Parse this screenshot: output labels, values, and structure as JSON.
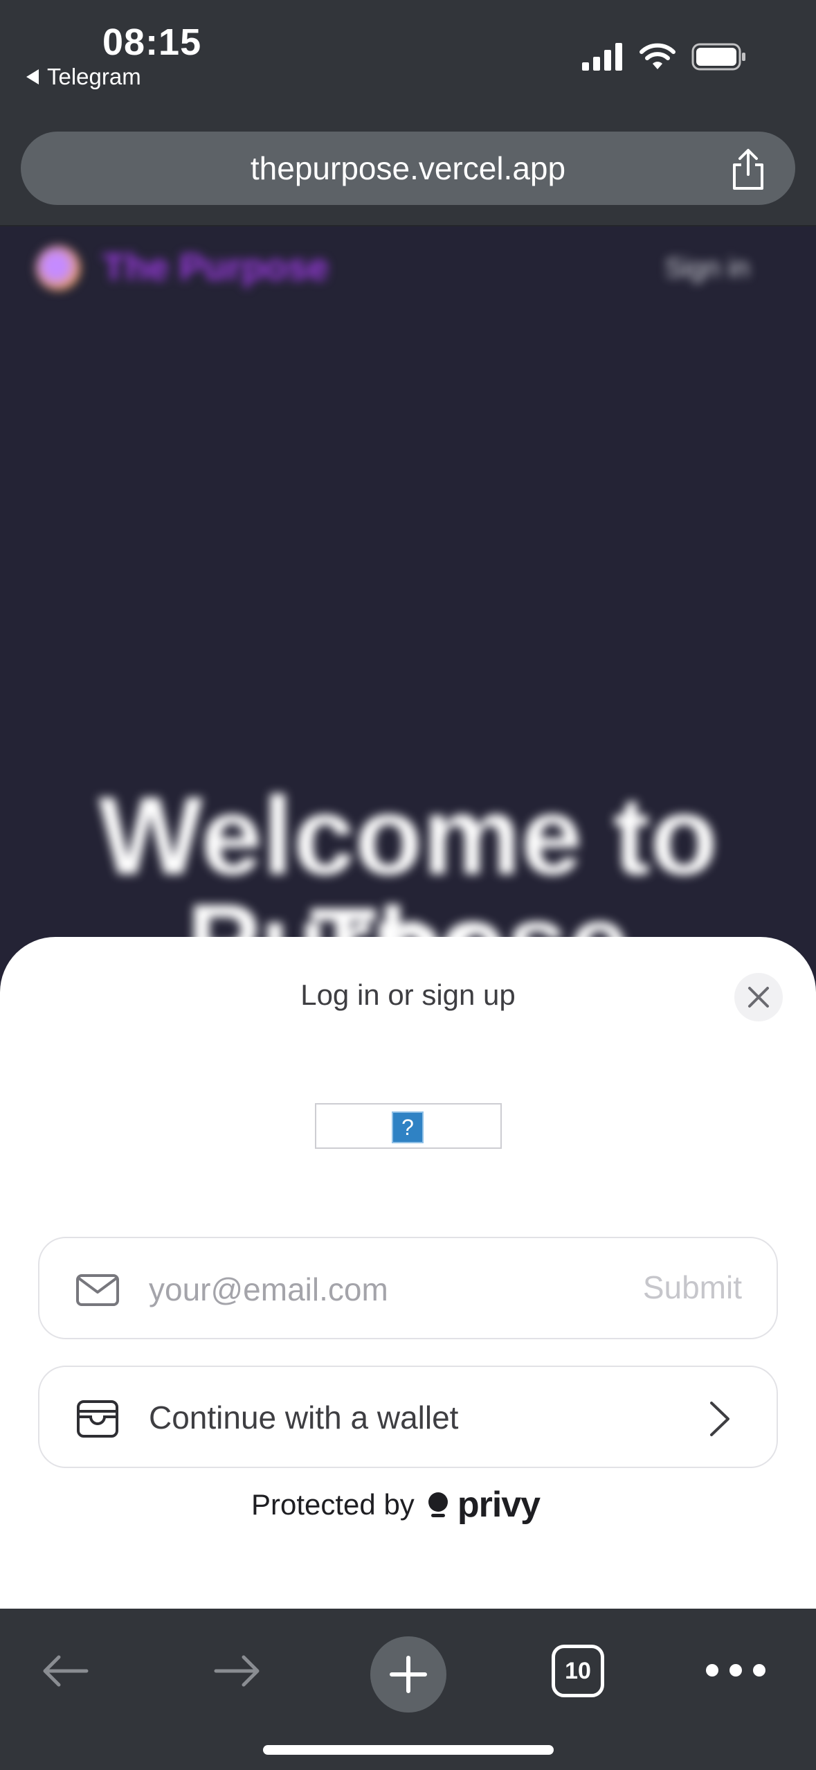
{
  "status_bar": {
    "time": "08:15",
    "back_app": "Telegram",
    "icons": [
      "signal-icon",
      "wifi-icon",
      "battery-icon"
    ]
  },
  "browser": {
    "url": "thepurpose.vercel.app",
    "tab_count": "10"
  },
  "page": {
    "brand": "The Purpose",
    "signin": "Sign in",
    "welcome_line1": "Welcome to The",
    "welcome_line2": "Purpose"
  },
  "modal": {
    "title": "Log in or sign up",
    "captcha_glyph": "?",
    "email_placeholder": "your@email.com",
    "submit_label": "Submit",
    "wallet_label": "Continue with a wallet",
    "protected_by": "Protected by",
    "provider": "privy"
  },
  "colors": {
    "chrome": "#32353a",
    "url_pill": "#5d6267",
    "page_bg": "#242335",
    "brand_purple": "#9b3be0",
    "sheet_bg": "#ffffff"
  }
}
